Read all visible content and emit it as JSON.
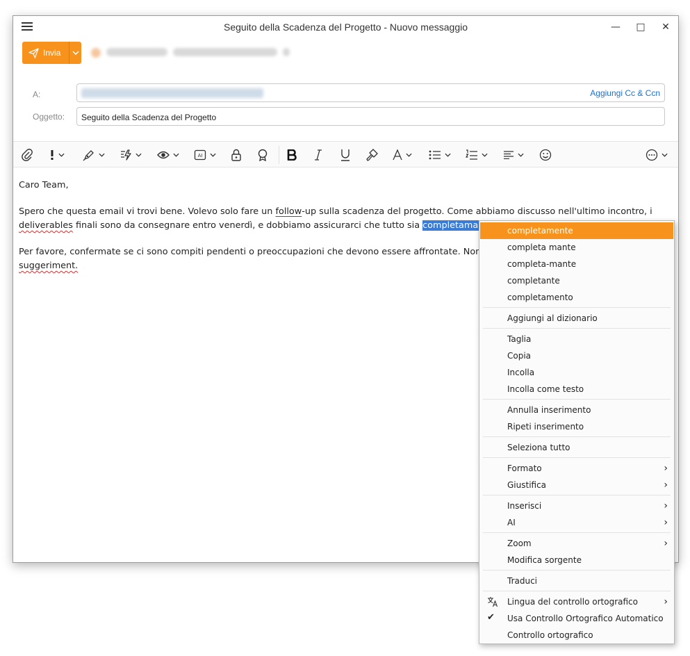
{
  "window": {
    "title": "Seguito della Scadenza del Progetto - Nuovo messaggio",
    "minimize": "—",
    "maximize": "□",
    "close": "✕"
  },
  "send": {
    "label": "Invia"
  },
  "fields": {
    "to_label": "A:",
    "cc_link": "Aggiungi Cc & Ccn",
    "subject_label": "Oggetto:",
    "subject_value": "Seguito della Scadenza del Progetto"
  },
  "toolbar": {
    "icons": [
      "attachment-icon",
      "importance-icon",
      "signature-icon",
      "quick-parts-icon",
      "read-receipt-icon",
      "ai-icon",
      "encrypt-icon",
      "certificate-icon",
      "bold-icon",
      "italic-icon",
      "underline-icon",
      "format-painter-icon",
      "font-color-icon",
      "bullet-list-icon",
      "numbered-list-icon",
      "align-icon",
      "emoji-icon",
      "more-options-icon"
    ]
  },
  "body": {
    "greeting": "Caro Team,",
    "p1_a": "Spero che questa email vi trovi bene. Volevo solo fare un ",
    "p1_follow": "follow",
    "p1_b": "-up sulla scadenza del progetto. Come abbiamo discusso nell'ultimo incontro, i ",
    "p1_deliverables": "deliverables",
    "p1_c": " finali sono da consegnare entro venerdì, e dobbiamo assicurarci che tutto sia ",
    "p1_selected": "completamante",
    "p2_a": "Per favore, confermate se ci sono compiti pendenti o preoccupazioni che devono essere affrontate. Non ",
    "p2_suggerimenti": "suggeriment."
  },
  "context_menu": {
    "suggestions": [
      "completamente",
      "completa mante",
      "completa-mante",
      "completante",
      "completamento"
    ],
    "add_dictionary": "Aggiungi al dizionario",
    "cut": "Taglia",
    "copy": "Copia",
    "paste": "Incolla",
    "paste_text": "Incolla come testo",
    "undo": "Annulla inserimento",
    "redo": "Ripeti inserimento",
    "select_all": "Seleziona tutto",
    "format": "Formato",
    "justify": "Giustifica",
    "insert": "Inserisci",
    "ai": "AI",
    "zoom": "Zoom",
    "edit_source": "Modifica sorgente",
    "translate": "Traduci",
    "spell_language": "Lingua del controllo ortografico",
    "auto_spell": "Usa Controllo Ortografico Automatico",
    "spell_check": "Controllo ortografico",
    "submenu_arrow": "›",
    "check_mark": "✔",
    "highlight_color": "#f7931d"
  }
}
